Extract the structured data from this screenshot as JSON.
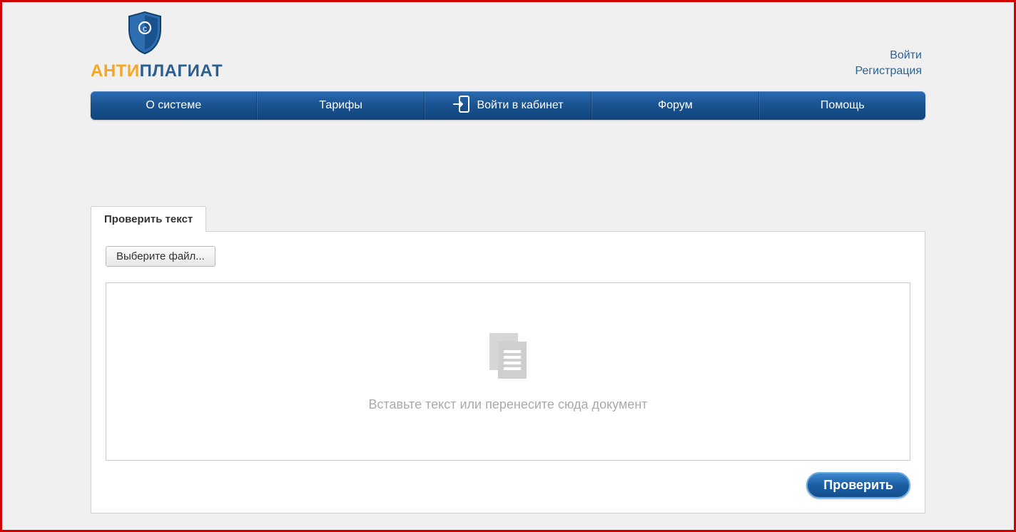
{
  "logo": {
    "part1": "АНТИ",
    "part2": "ПЛАГИАТ"
  },
  "auth": {
    "login": "Войти",
    "register": "Регистрация"
  },
  "nav": {
    "about": "О системе",
    "tariffs": "Тарифы",
    "cabinet": "Войти в кабинет",
    "forum": "Форум",
    "help": "Помощь"
  },
  "tab": {
    "check_text": "Проверить текст"
  },
  "panel": {
    "choose_file": "Выберите файл...",
    "placeholder": "Вставьте текст или перенесите сюда документ",
    "check_button": "Проверить"
  }
}
